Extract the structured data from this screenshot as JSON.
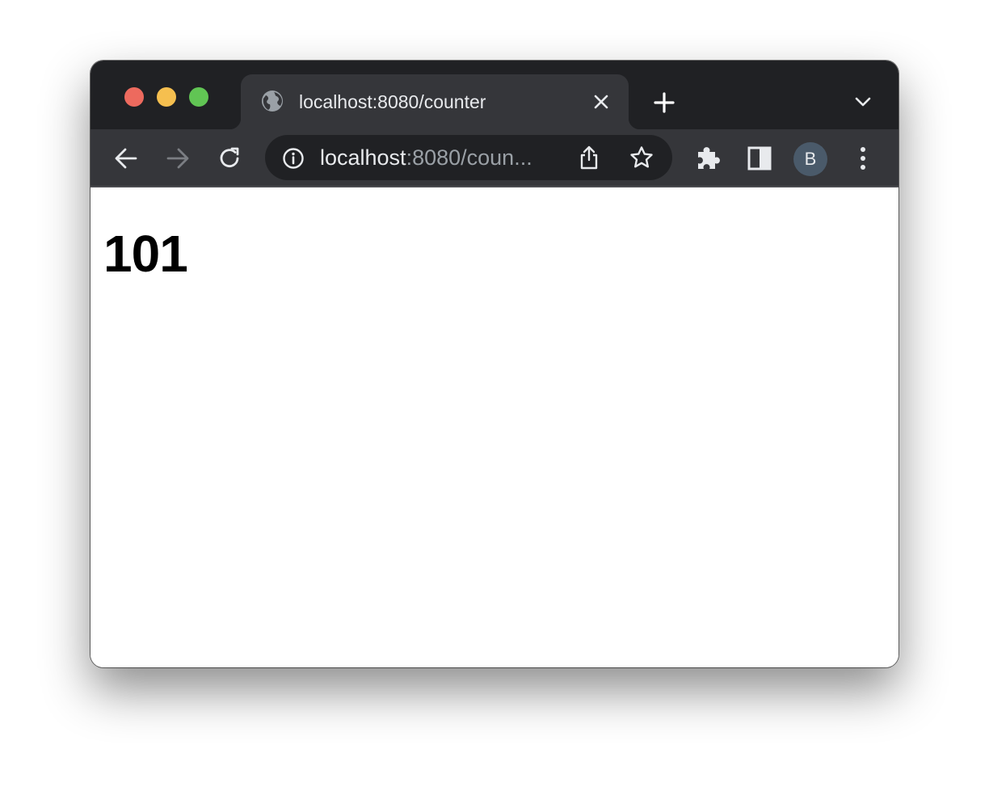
{
  "colors": {
    "tabstrip_bg": "#202124",
    "toolbar_bg": "#35363a",
    "omnibox_bg": "#202124",
    "text_primary": "#e8eaed",
    "text_secondary": "#9aa0a6",
    "close_red": "#ed6a5e",
    "minimize_yellow": "#f5bf4f",
    "zoom_green": "#61c554",
    "avatar_bg": "#4a5a6a"
  },
  "tab": {
    "title": "localhost:8080/counter",
    "favicon": "globe-icon"
  },
  "icons": {
    "tab_close": "close-icon",
    "new_tab": "plus-icon",
    "tab_search": "chevron-down-icon",
    "back": "back-arrow-icon",
    "forward": "forward-arrow-icon",
    "reload": "reload-icon",
    "site_info": "info-icon",
    "share": "share-icon",
    "bookmark": "star-icon",
    "extensions": "puzzle-icon",
    "side_panel": "side-panel-icon",
    "menu": "kebab-menu-icon"
  },
  "omnibox": {
    "host": "localhost",
    "rest": ":8080/coun..."
  },
  "profile": {
    "initial": "B"
  },
  "page": {
    "counter": "101"
  }
}
